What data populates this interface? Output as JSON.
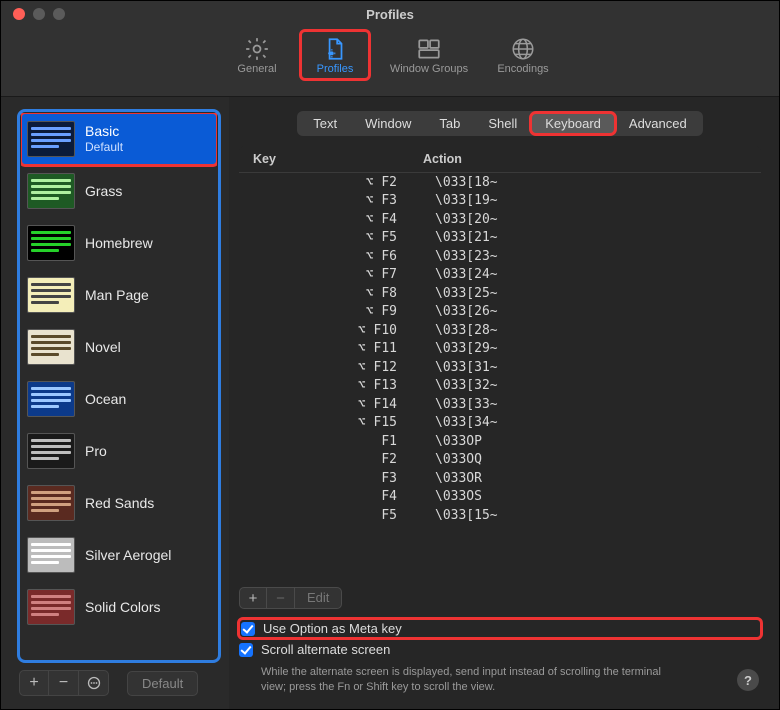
{
  "window": {
    "title": "Profiles"
  },
  "toolbar": {
    "items": [
      {
        "id": "general",
        "label": "General"
      },
      {
        "id": "profiles",
        "label": "Profiles"
      },
      {
        "id": "window-groups",
        "label": "Window Groups"
      },
      {
        "id": "encodings",
        "label": "Encodings"
      }
    ]
  },
  "sidebar": {
    "profiles": [
      {
        "name": "Basic",
        "sub": "Default",
        "thumb_bg": "#0b1b3a",
        "bar": "#6aa0ff"
      },
      {
        "name": "Grass",
        "sub": "",
        "thumb_bg": "#1e5a24",
        "bar": "#aef0a0"
      },
      {
        "name": "Homebrew",
        "sub": "",
        "thumb_bg": "#000000",
        "bar": "#26d12a"
      },
      {
        "name": "Man Page",
        "sub": "",
        "thumb_bg": "#f4eeb9",
        "bar": "#444444"
      },
      {
        "name": "Novel",
        "sub": "",
        "thumb_bg": "#e9e3cf",
        "bar": "#5a4a2a"
      },
      {
        "name": "Ocean",
        "sub": "",
        "thumb_bg": "#0c3a8a",
        "bar": "#9cc8ff"
      },
      {
        "name": "Pro",
        "sub": "",
        "thumb_bg": "#1a1a1a",
        "bar": "#bdbdbd"
      },
      {
        "name": "Red Sands",
        "sub": "",
        "thumb_bg": "#5a2a20",
        "bar": "#d0a080"
      },
      {
        "name": "Silver Aerogel",
        "sub": "",
        "thumb_bg": "#bcbcbc",
        "bar": "#ffffff"
      },
      {
        "name": "Solid Colors",
        "sub": "",
        "thumb_bg": "#7a2a2a",
        "bar": "#d08080"
      }
    ],
    "footer": {
      "add": "+",
      "remove": "−",
      "more": "⊙",
      "default_btn": "Default"
    }
  },
  "tabs": {
    "items": [
      "Text",
      "Window",
      "Tab",
      "Shell",
      "Keyboard",
      "Advanced"
    ],
    "active": "Keyboard"
  },
  "table": {
    "headers": {
      "key": "Key",
      "action": "Action"
    },
    "rows": [
      {
        "key": "⌥ F2",
        "action": "\\033[18~"
      },
      {
        "key": "⌥ F3",
        "action": "\\033[19~"
      },
      {
        "key": "⌥ F4",
        "action": "\\033[20~"
      },
      {
        "key": "⌥ F5",
        "action": "\\033[21~"
      },
      {
        "key": "⌥ F6",
        "action": "\\033[23~"
      },
      {
        "key": "⌥ F7",
        "action": "\\033[24~"
      },
      {
        "key": "⌥ F8",
        "action": "\\033[25~"
      },
      {
        "key": "⌥ F9",
        "action": "\\033[26~"
      },
      {
        "key": "⌥ F10",
        "action": "\\033[28~"
      },
      {
        "key": "⌥ F11",
        "action": "\\033[29~"
      },
      {
        "key": "⌥ F12",
        "action": "\\033[31~"
      },
      {
        "key": "⌥ F13",
        "action": "\\033[32~"
      },
      {
        "key": "⌥ F14",
        "action": "\\033[33~"
      },
      {
        "key": "⌥ F15",
        "action": "\\033[34~"
      },
      {
        "key": "F1",
        "action": "\\033OP"
      },
      {
        "key": "F2",
        "action": "\\033OQ"
      },
      {
        "key": "F3",
        "action": "\\033OR"
      },
      {
        "key": "F4",
        "action": "\\033OS"
      },
      {
        "key": "F5",
        "action": "\\033[15~"
      }
    ],
    "toolbar": {
      "add": "+",
      "remove": "−",
      "edit": "Edit"
    }
  },
  "options": {
    "meta": "Use Option as Meta key",
    "scroll": "Scroll alternate screen",
    "hint": "While the alternate screen is displayed, send input instead of scrolling the terminal view; press the Fn or Shift key to scroll the view."
  },
  "help": "?"
}
